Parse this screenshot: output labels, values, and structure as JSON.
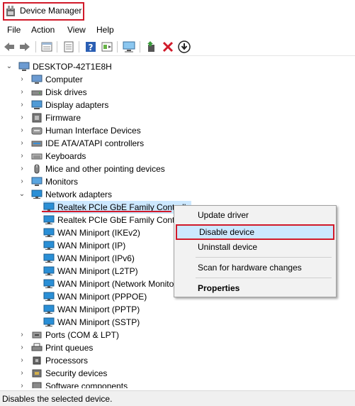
{
  "window": {
    "title": "Device Manager"
  },
  "menu": [
    "File",
    "Action",
    "View",
    "Help"
  ],
  "toolbar_icons": [
    "back-icon",
    "forward-icon",
    "properties-grid-icon",
    "update-list-icon",
    "help-icon",
    "view-icon",
    "monitor-icon",
    "add-driver-icon",
    "remove-icon",
    "download-icon"
  ],
  "tree": {
    "root": "DESKTOP-42T1E8H",
    "categories": [
      "Computer",
      "Disk drives",
      "Display adapters",
      "Firmware",
      "Human Interface Devices",
      "IDE ATA/ATAPI controllers",
      "Keyboards",
      "Mice and other pointing devices",
      "Monitors",
      "Network adapters"
    ],
    "network_children": [
      "Realtek PCIe GbE Family Controller",
      "Realtek PCIe GbE Family Controller",
      "WAN Miniport (IKEv2)",
      "WAN Miniport (IP)",
      "WAN Miniport (IPv6)",
      "WAN Miniport (L2TP)",
      "WAN Miniport (Network Monitor)",
      "WAN Miniport (PPPOE)",
      "WAN Miniport (PPTP)",
      "WAN Miniport (SSTP)"
    ],
    "after": [
      "Ports (COM & LPT)",
      "Print queues",
      "Processors",
      "Security devices",
      "Software components"
    ]
  },
  "context_menu": {
    "update": "Update driver",
    "disable": "Disable device",
    "uninstall": "Uninstall device",
    "scan": "Scan for hardware changes",
    "properties": "Properties"
  },
  "status": "Disables the selected device.",
  "colors": {
    "highlight_red": "#d11a2a",
    "selection_blue": "#cce8ff",
    "net_icon_blue": "#2a8fd6"
  }
}
